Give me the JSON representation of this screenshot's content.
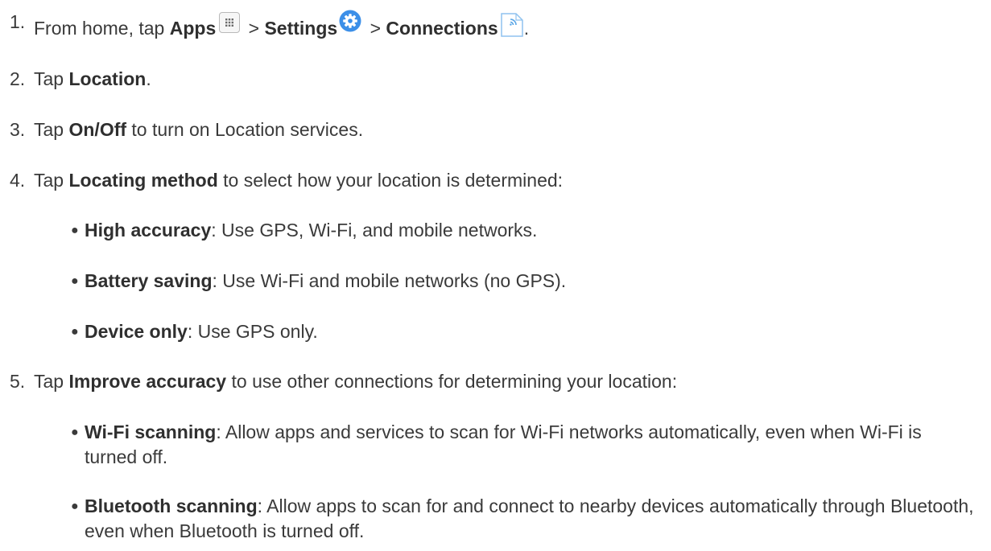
{
  "steps": [
    {
      "num": "1.",
      "prefix": "From home, tap ",
      "apps": "Apps",
      "sep1": " > ",
      "settings": "Settings",
      "sep2": " > ",
      "connections": "Connections",
      "suffix": "."
    },
    {
      "num": "2.",
      "prefix": "Tap ",
      "bold": "Location",
      "suffix": "."
    },
    {
      "num": "3.",
      "prefix": "Tap ",
      "bold": "On/Off",
      "suffix": " to turn on Location services."
    },
    {
      "num": "4.",
      "prefix": "Tap ",
      "bold": "Locating method",
      "suffix": " to select how your location is determined:",
      "bullets": [
        {
          "bold": "High accuracy",
          "text": ": Use GPS, Wi-Fi, and mobile networks."
        },
        {
          "bold": "Battery saving",
          "text": ": Use Wi-Fi and mobile networks (no GPS)."
        },
        {
          "bold": "Device only",
          "text": ": Use GPS only."
        }
      ]
    },
    {
      "num": "5.",
      "prefix": "Tap ",
      "bold": "Improve accuracy",
      "suffix": " to use other connections for determining your location:",
      "bullets": [
        {
          "bold": "Wi-Fi scanning",
          "text": ": Allow apps and services to scan for Wi-Fi networks automatically, even when Wi-Fi is turned off."
        },
        {
          "bold": "Bluetooth scanning",
          "text": ": Allow apps to scan for and connect to nearby devices automatically through Bluetooth, even when Bluetooth is turned off."
        }
      ]
    }
  ],
  "bullet_glyph": "●",
  "icons": {
    "apps": "apps-grid-icon",
    "settings": "settings-gear-icon",
    "connections": "connections-icon"
  },
  "colors": {
    "text": "#3a3a3a",
    "settings_blue": "#3c8fe8",
    "connections_blue": "#5aa6e6"
  }
}
